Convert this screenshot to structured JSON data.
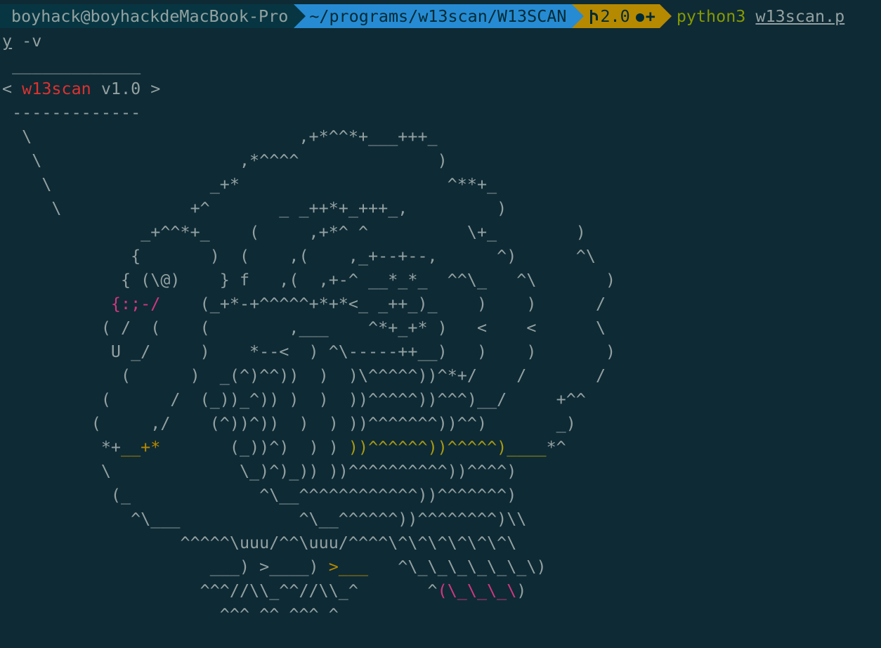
{
  "prompt": {
    "user_host": "boyhack@boyhackdeMacBook-Pro",
    "path": "~/programs/w13scan/W13SCAN",
    "git_branch": "2.0",
    "command": "python3",
    "command_arg": "w13scan.p",
    "wrap_line_arg": "y",
    "wrap_line_flag": " -v"
  },
  "banner": {
    "top_border": " _____________",
    "open": "< ",
    "name": "w13scan",
    "version": " v1.0",
    "close": " >",
    "bottom_border": " -------------"
  },
  "art": {
    "l01": "  \\                           ,+*^^*+___+++_",
    "l02": "   \\                    ,*^^^^              )",
    "l03": "    \\                _+*                     ^**+_",
    "l04": "     \\             +^       _ _++*+_+++_,         )",
    "l05a": "              _+^^*+_    (     ,+*^ ^          \\+_        )",
    "l06": "             {       )  (    ,(    ,_+--+--,      ^)      ^\\",
    "l07": "            { (\\@)    } f   ,(  ,+-^ __*_*_  ^^\\_   ^\\       )",
    "l08a": "           ",
    "l08b": "{:;-/",
    "l08c": "    (_+*-+^^^^^+*+*<_ _++_)_    )    )      /",
    "l09": "          ( /  (    (        ,___    ^*+_+* )   <    <      \\",
    "l10": "           U _/     )    *--<  ) ^\\-----++__)   )    )       )",
    "l11": "            (      )  _(^)^^))  )  )\\^^^^^))^*+/    /       /",
    "l12": "          (      /  (_))_^)) )  )  ))^^^^^))^^^)__/     +^^",
    "l13": "         (     ,/    (^))^))  )  ) ))^^^^^^^))^^)       _)",
    "l14a": "          *+",
    "l14b": "__+*",
    "l14c": "       (_))^)  ) ) ",
    "l14d": "))^^^^^^))^^^^^)____",
    "l14e": "*^",
    "l15": "          \\             \\_)^)_)) ))^^^^^^^^^^))^^^^)",
    "l16": "           (_             ^\\__^^^^^^^^^^^^))^^^^^^^)",
    "l17": "             ^\\___            ^\\__^^^^^^))^^^^^^^^)\\\\",
    "l18": "                  ^^^^^\\uuu/^^\\uuu/^^^^\\^\\^\\^\\^\\^\\^\\",
    "l19a": "                     ___) >____) ",
    "l19b": ">___",
    "l19c": "   ^\\_\\_\\_\\_\\_\\_\\)",
    "l20a": "                    ^^^//\\\\_^^//\\\\_^       ^",
    "l20b": "(\\_\\_\\_\\",
    "l20c": ")",
    "l21": "                      ^^^ ^^ ^^^ ^"
  },
  "colors": {
    "background": "#0e2a35",
    "text": "#93a1a1",
    "segment_user": "#073642",
    "segment_path": "#268bd2",
    "segment_git": "#b58900",
    "command": "#859900",
    "banner_name": "#dc322f",
    "pink": "#d33682",
    "yellow": "#b58900"
  },
  "icons": {
    "git_branch": "git-branch-icon",
    "dirty": "dirty-circle-icon",
    "plus": "plus-icon"
  }
}
